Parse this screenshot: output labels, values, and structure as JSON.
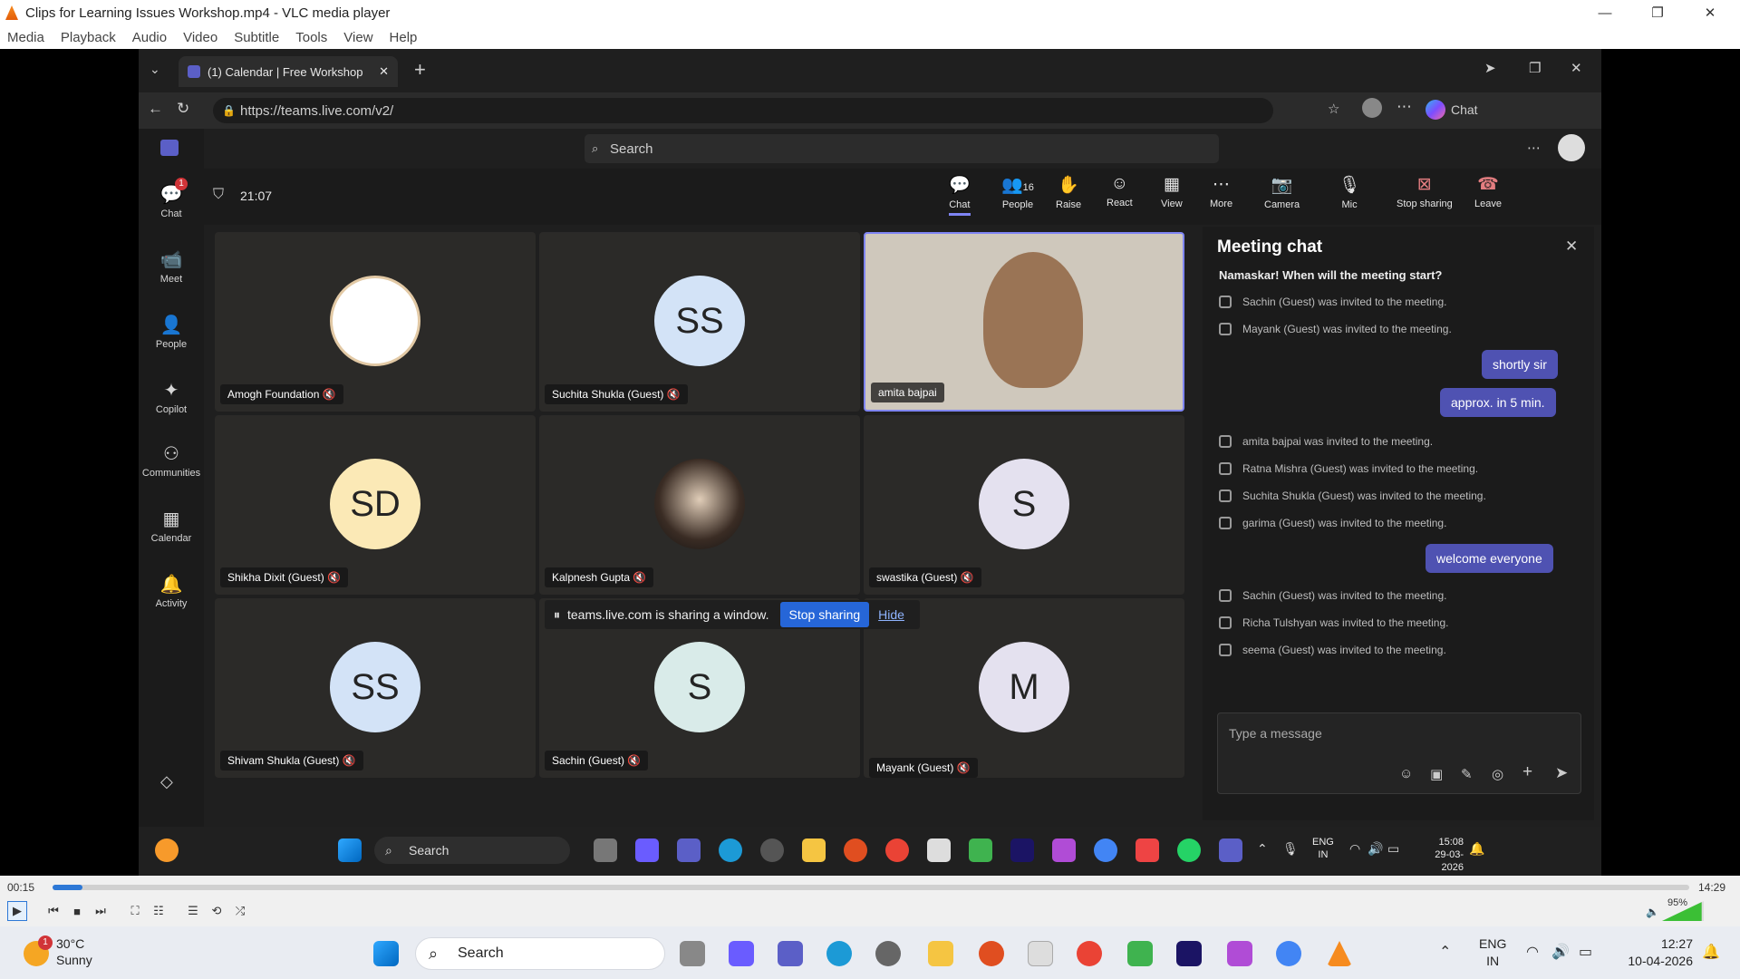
{
  "vlc": {
    "title": "Clips for Learning Issues Workshop.mp4 - VLC media player",
    "menu": [
      "Media",
      "Playback",
      "Audio",
      "Video",
      "Subtitle",
      "Tools",
      "View",
      "Help"
    ],
    "elapsed": "00:15",
    "total": "14:29",
    "progress": 0.018,
    "volume": "95%"
  },
  "browser": {
    "tab_title": "(1) Calendar | Free Workshop",
    "url": "https://teams.live.com/v2/",
    "chat_label": "Chat"
  },
  "teams": {
    "search_placeholder": "Search",
    "chat_badge": "1",
    "rail": [
      "Chat",
      "Meet",
      "People",
      "Copilot",
      "Communities",
      "Calendar",
      "Activity"
    ],
    "timer": "21:07",
    "people_count": "16",
    "toolbar": [
      "Chat",
      "People",
      "Raise",
      "React",
      "View",
      "More",
      "Camera",
      "Mic",
      "Stop sharing",
      "Leave"
    ],
    "tiles": [
      {
        "name": "Amogh Foundation",
        "initials": "",
        "color": "#ffffff",
        "kind": "logo"
      },
      {
        "name": "Suchita Shukla (Guest)",
        "initials": "SS",
        "color": "#d3e3f7"
      },
      {
        "name": "amita bajpai",
        "initials": "",
        "color": "#c9c2b6",
        "kind": "video"
      },
      {
        "name": "Shikha Dixit (Guest)",
        "initials": "SD",
        "color": "#fbe9b6"
      },
      {
        "name": "Kalpnesh Gupta",
        "initials": "",
        "color": "#3a2c24",
        "kind": "photo"
      },
      {
        "name": "swastika (Guest)",
        "initials": "S",
        "color": "#e4e1ef"
      },
      {
        "name": "Shivam Shukla (Guest)",
        "initials": "SS",
        "color": "#d3e3f7"
      },
      {
        "name": "Sachin (Guest)",
        "initials": "S",
        "color": "#d9ebe9"
      },
      {
        "name": "Mayank (Guest)",
        "initials": "M",
        "color": "#e4e1ef"
      }
    ],
    "chat": {
      "title": "Meeting chat",
      "first_message": "Namaskar! When will the meeting start?",
      "messages": [
        {
          "type": "sys",
          "text": "Sachin (Guest) was invited to the meeting."
        },
        {
          "type": "sys",
          "text": "Mayank (Guest) was invited to the meeting."
        },
        {
          "type": "me",
          "text": "shortly sir"
        },
        {
          "type": "me",
          "text": "approx. in 5 min."
        },
        {
          "type": "sys",
          "text": "amita bajpai was invited to the meeting."
        },
        {
          "type": "sys",
          "text": "Ratna Mishra (Guest) was invited to the meeting."
        },
        {
          "type": "sys",
          "text": "Suchita Shukla (Guest) was invited to the meeting."
        },
        {
          "type": "sys",
          "text": "garima (Guest) was invited to the meeting."
        },
        {
          "type": "me",
          "text": "welcome everyone"
        },
        {
          "type": "sys",
          "text": "Sachin (Guest) was invited to the meeting."
        },
        {
          "type": "sys",
          "text": "Richa Tulshyan was invited to the meeting."
        },
        {
          "type": "sys",
          "text": "seema (Guest) was invited to the meeting."
        }
      ],
      "compose_placeholder": "Type a message"
    },
    "share_banner": {
      "text": "teams.live.com is sharing a window.",
      "stop": "Stop sharing",
      "hide": "Hide"
    }
  },
  "inner_taskbar": {
    "search": "Search",
    "lang": "ENG",
    "region": "IN",
    "time": "15:08",
    "date": "29-03-2026"
  },
  "os_taskbar": {
    "temp": "30°C",
    "weather": "Sunny",
    "weather_badge": "1",
    "search": "Search",
    "lang": "ENG",
    "region": "IN",
    "time": "12:27",
    "date": "10-04-2026"
  },
  "colors": {
    "teams_accent": "#4f52b2",
    "share_blue": "#2666d8",
    "vlc_orange": "#f68b1f",
    "volume_green": "#3bbf35"
  }
}
